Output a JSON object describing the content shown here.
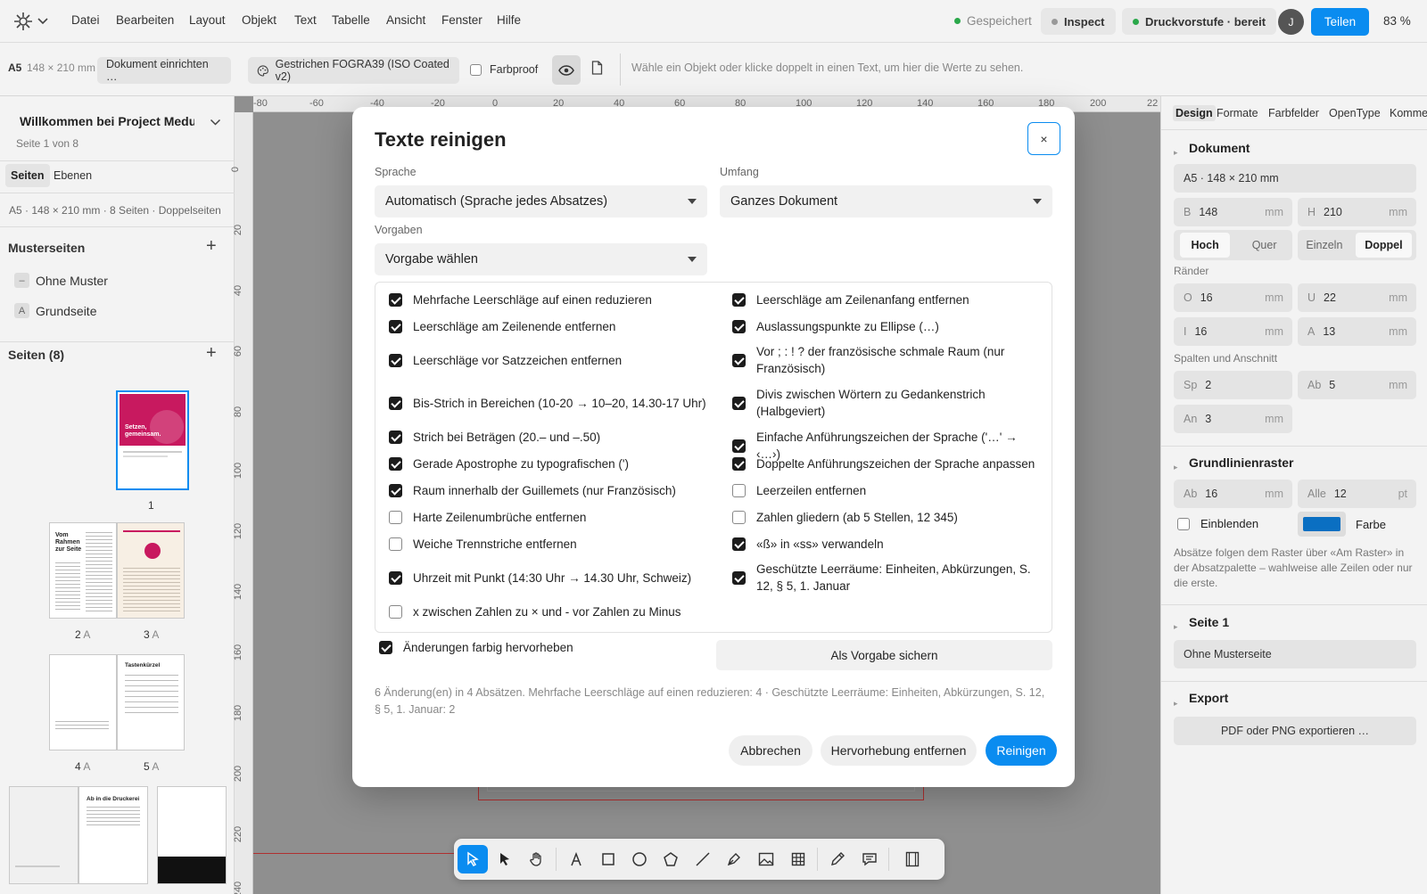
{
  "menubar": {
    "items": [
      "Datei",
      "Bearbeiten",
      "Layout",
      "Objekt",
      "Text",
      "Tabelle",
      "Ansicht",
      "Fenster",
      "Hilfe"
    ],
    "status_saved": "Gespeichert",
    "inspect": "Inspect",
    "prepress": "Druckvorstufe · bereit",
    "avatar": "J",
    "share": "Teilen",
    "zoom": "83 %"
  },
  "toolbar2": {
    "size_tag": "A5",
    "size": "148 × 210 mm",
    "setup": "Dokument einrichten …",
    "profile": "Gestrichen FOGRA39 (ISO Coated v2)",
    "proof": "Farbproof",
    "hint": "Wähle ein Objekt oder klicke doppelt in einen Text, um hier die Werte zu sehen."
  },
  "left": {
    "doc_title": "Willkommen bei Project Medu",
    "page_of": "Seite 1 von 8",
    "tabs": [
      "Seiten",
      "Ebenen"
    ],
    "doc_info": "A5 · 148 × 210 mm · 8 Seiten · Doppelseiten",
    "masters_head": "Musterseiten",
    "masters": [
      {
        "badge": "–",
        "label": "Ohne Muster"
      },
      {
        "badge": "A",
        "label": "Grundseite"
      }
    ],
    "pages_head": "Seiten (8)",
    "thumb1_text": "Setzen, gemeinsam.",
    "thumb2_text": "Vom Rahmen zur Seite",
    "thumb5_text": "Tastenkürzel",
    "thumb6_text": "Ab in die Druckerei",
    "page_labels": [
      "1",
      "2",
      "A",
      "3",
      "A",
      "4",
      "A",
      "5",
      "A"
    ]
  },
  "ruler": {
    "top": [
      "-80",
      "-60",
      "-40",
      "-20",
      "0",
      "20",
      "40",
      "60",
      "80",
      "100",
      "120",
      "140",
      "160",
      "180",
      "200",
      "22"
    ],
    "left": [
      "0",
      "20",
      "40",
      "60",
      "80",
      "100",
      "120",
      "140",
      "160",
      "180",
      "200",
      "220",
      "240"
    ]
  },
  "right": {
    "tabs": [
      "Design",
      "Formate",
      "Farbfelder",
      "OpenType",
      "Komme"
    ],
    "doc_head": "Dokument",
    "doc_size": "A5 · 148 × 210 mm",
    "b_label": "B",
    "b_val": "148",
    "unit_mm": "mm",
    "h_label": "H",
    "h_val": "210",
    "orient": [
      "Hoch",
      "Quer"
    ],
    "spread": [
      "Einzeln",
      "Doppel"
    ],
    "margins_head": "Ränder",
    "m_o": "O",
    "m_o_val": "16",
    "m_u": "U",
    "m_u_val": "22",
    "m_i": "I",
    "m_i_val": "16",
    "m_a": "A",
    "m_a_val": "13",
    "cols_head": "Spalten und Anschnitt",
    "sp": "Sp",
    "sp_val": "2",
    "ab": "Ab",
    "ab_val": "5",
    "an": "An",
    "an_val": "3",
    "grid_head": "Grundlinienraster",
    "g_ab": "Ab",
    "g_ab_val": "16",
    "g_alle": "Alle",
    "g_alle_val": "12",
    "unit_pt": "pt",
    "show": "Einblenden",
    "color_label": "Farbe",
    "color": "#0a6fc2",
    "grid_note": "Absätze folgen dem Raster über «Am Raster» in der Absatzpalette – wahlweise alle Zeilen oder nur die erste.",
    "page_head": "Seite 1",
    "page_master": "Ohne Musterseite",
    "export_head": "Export",
    "export_btn": "PDF oder PNG exportieren …"
  },
  "modal": {
    "title": "Texte reinigen",
    "close": "×",
    "lang_label": "Sprache",
    "lang_value": "Automatisch (Sprache jedes Absatzes)",
    "scope_label": "Umfang",
    "scope_value": "Ganzes Dokument",
    "preset_label": "Vorgaben",
    "preset_value": "Vorgabe wählen",
    "left_options": [
      {
        "label": "Mehrfache Leerschläge auf einen reduzieren",
        "checked": true
      },
      {
        "label": "Leerschläge am Zeilenende entfernen",
        "checked": true
      },
      {
        "label": "Leerschläge vor Satzzeichen entfernen",
        "checked": true
      },
      {
        "label": "Bis-Strich in Bereichen (10-20 → 10–20, 14.30-17 Uhr)",
        "checked": true
      },
      {
        "label": "Strich bei Beträgen (20.– und –.50)",
        "checked": true
      },
      {
        "label": "Gerade Apostrophe zu typografischen (')",
        "checked": true
      },
      {
        "label": "Raum innerhalb der Guillemets (nur Französisch)",
        "checked": true
      },
      {
        "label": "Harte Zeilenumbrüche entfernen",
        "checked": false
      },
      {
        "label": "Weiche Trennstriche entfernen",
        "checked": false
      },
      {
        "label": "Uhrzeit mit Punkt (14:30 Uhr → 14.30 Uhr, Schweiz)",
        "checked": true
      },
      {
        "label": "x zwischen Zahlen zu × und - vor Zahlen zu Minus",
        "checked": false
      }
    ],
    "right_options": [
      {
        "label": "Leerschläge am Zeilenanfang entfernen",
        "checked": true
      },
      {
        "label": "Auslassungspunkte zu Ellipse (…)",
        "checked": true
      },
      {
        "label": "Vor ; : ! ? der französische schmale Raum (nur Französisch)",
        "checked": true
      },
      {
        "label": "Divis zwischen Wörtern zu Gedankenstrich (Halbgeviert)",
        "checked": true
      },
      {
        "label": "Einfache Anführungszeichen der Sprache ('…' → ‹…›)",
        "checked": true
      },
      {
        "label": "Doppelte Anführungszeichen der Sprache anpassen",
        "checked": true
      },
      {
        "label": "Leerzeilen entfernen",
        "checked": false
      },
      {
        "label": "Zahlen gliedern (ab 5 Stellen, 12 345)",
        "checked": false
      },
      {
        "label": "«ß» in «ss» verwandeln",
        "checked": true
      },
      {
        "label": "Geschützte Leerräume: Einheiten, Abkürzungen, S. 12, § 5, 1. Januar",
        "checked": true
      }
    ],
    "highlight_label": "Änderungen farbig hervorheben",
    "highlight_checked": true,
    "save_preset": "Als Vorgabe sichern",
    "summary": "6 Änderung(en) in 4 Absätzen. Mehrfache Leerschläge auf einen reduzieren: 4 · Geschützte Leerräume: Einheiten, Abkürzungen, S. 12, § 5, 1. Januar: 2",
    "cancel": "Abbrechen",
    "remove_highlight": "Hervorhebung entfernen",
    "clean": "Reinigen",
    "accent": "#0a8cf0"
  },
  "dock": {
    "tools": [
      "select-tool-icon",
      "direct-select-icon",
      "hand-icon",
      "text-tool-icon",
      "rectangle-icon",
      "ellipse-icon",
      "polygon-icon",
      "line-icon",
      "pen-icon",
      "image-frame-icon",
      "table-icon",
      "pencil-icon",
      "comment-icon",
      "frame-grid-icon"
    ]
  }
}
